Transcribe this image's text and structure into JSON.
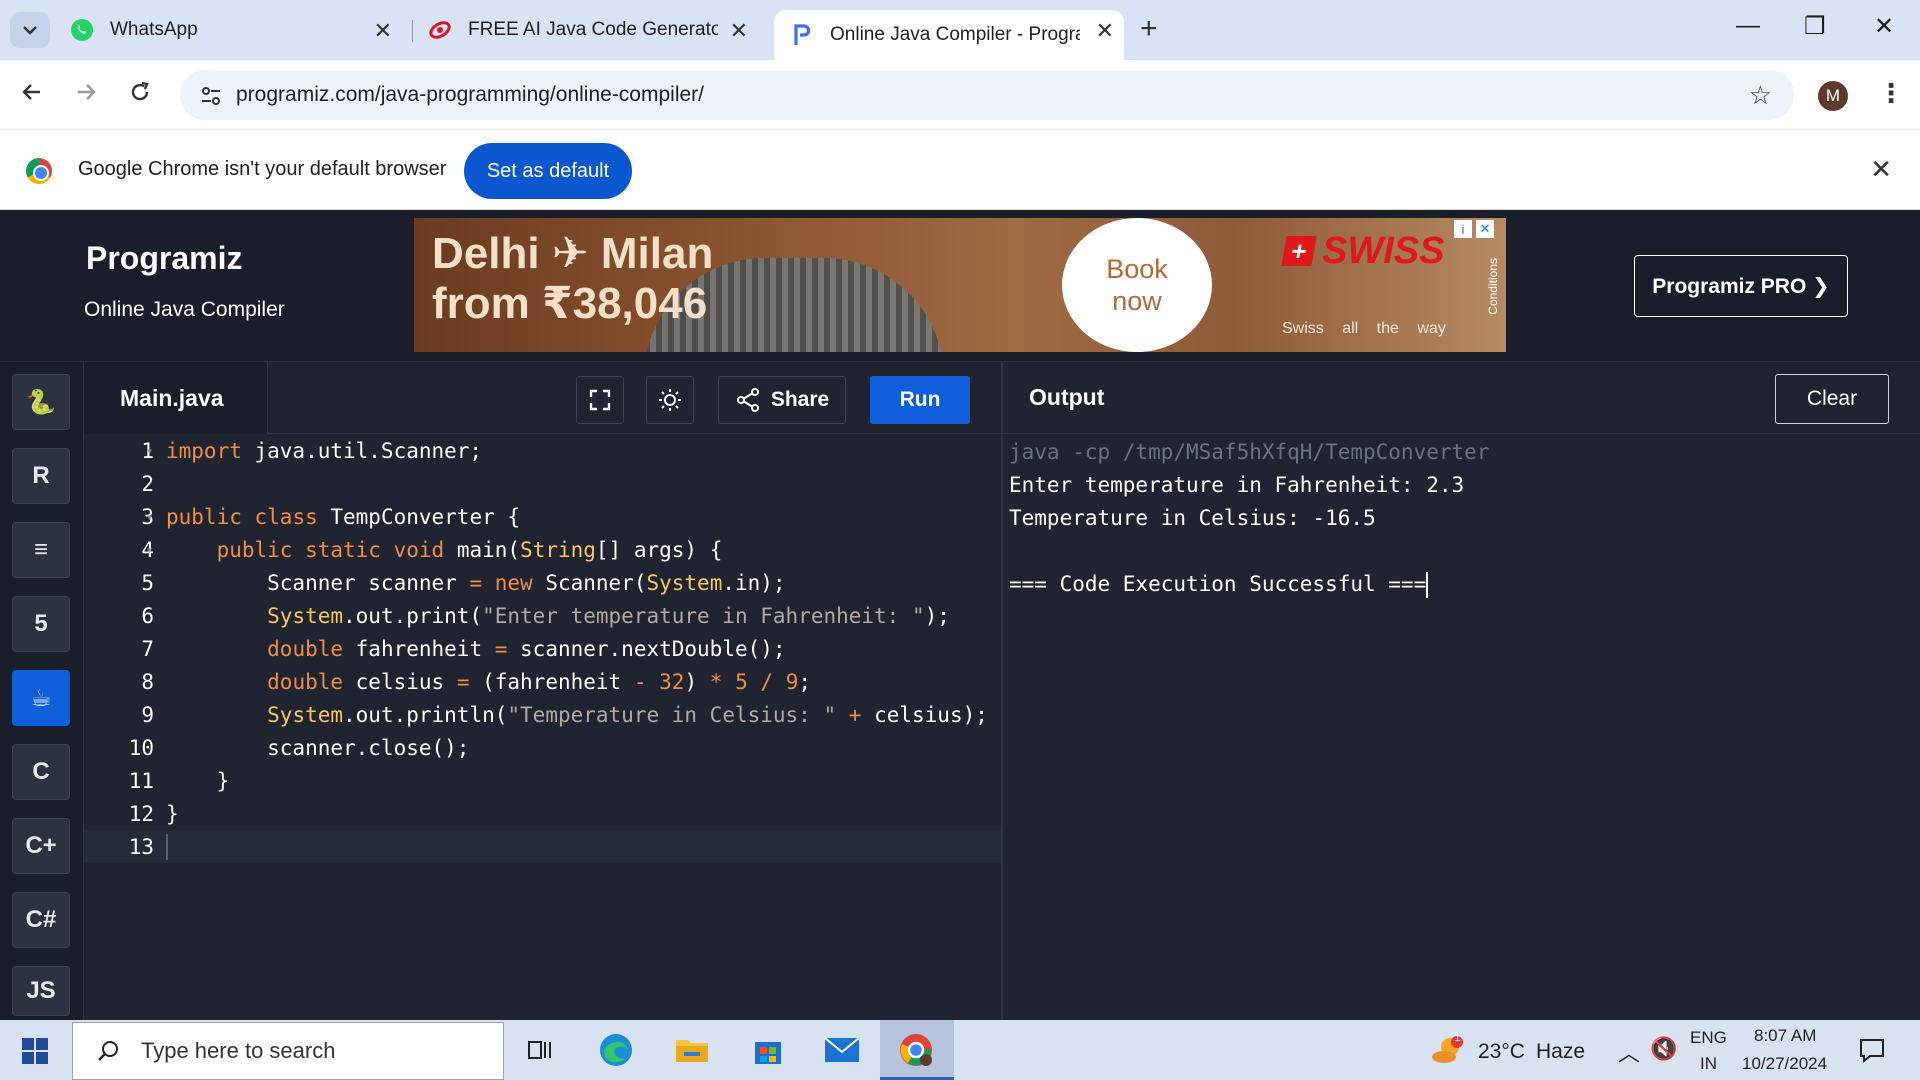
{
  "browser": {
    "tabs": [
      {
        "title": "WhatsApp",
        "close": "✕"
      },
      {
        "title": "FREE AI Java Code Generator: G",
        "close": "✕"
      },
      {
        "title": "Online Java Compiler - Program",
        "close": "✕"
      }
    ],
    "new_tab": "+",
    "window_controls": {
      "minimize": "—",
      "restore": "❐",
      "close": "✕"
    },
    "url": "programiz.com/java-programming/online-compiler/",
    "profile_initial": "M"
  },
  "infobar": {
    "message": "Google Chrome isn't your default browser",
    "button": "Set as default"
  },
  "site": {
    "logo": "Programiz",
    "subtitle": "Online Java Compiler",
    "pro_button": "Programiz PRO ❯",
    "ad": {
      "line1": "Delhi ✈ Milan",
      "line2": "from ₹38,046",
      "cta_line1": "Book",
      "cta_line2": "now",
      "brand": "SWISS",
      "tagline": "Swiss all the way",
      "conditions": "Conditions"
    }
  },
  "rail": {
    "items": [
      {
        "icon": "python-icon",
        "glyph": "🐍"
      },
      {
        "icon": "r-language-icon",
        "glyph": "R"
      },
      {
        "icon": "database-icon",
        "glyph": "≡"
      },
      {
        "icon": "html5-icon",
        "glyph": "5"
      },
      {
        "icon": "java-icon",
        "glyph": "☕"
      },
      {
        "icon": "c-icon",
        "glyph": "C"
      },
      {
        "icon": "cplusplus-icon",
        "glyph": "C+"
      },
      {
        "icon": "csharp-icon",
        "glyph": "C#"
      },
      {
        "icon": "javascript-icon",
        "glyph": "JS"
      }
    ]
  },
  "editor": {
    "file_name": "Main.java",
    "share_label": "Share",
    "run_label": "Run",
    "line_numbers": [
      "1",
      "2",
      "3",
      "4",
      "5",
      "6",
      "7",
      "8",
      "9",
      "10",
      "11",
      "12",
      "13"
    ]
  },
  "output": {
    "title": "Output",
    "clear_label": "Clear",
    "lines": [
      "java -cp /tmp/MSaf5hXfqH/TempConverter",
      "Enter temperature in Fahrenheit: 2.3",
      "Temperature in Celsius: -16.5",
      "",
      "=== Code Execution Successful ==="
    ]
  },
  "taskbar": {
    "search_placeholder": "Type here to search",
    "weather_temp": "23°C",
    "weather_desc": "Haze",
    "lang_top": "ENG",
    "lang_bottom": "IN",
    "time": "8:07 AM",
    "date": "10/27/2024",
    "weather_badge": "1"
  },
  "colors": {
    "accent": "#0f5fdc",
    "editor_bg": "#1f2430",
    "keyword": "#f08d49",
    "type": "#f6c85f",
    "string": "#b2a9a2"
  }
}
